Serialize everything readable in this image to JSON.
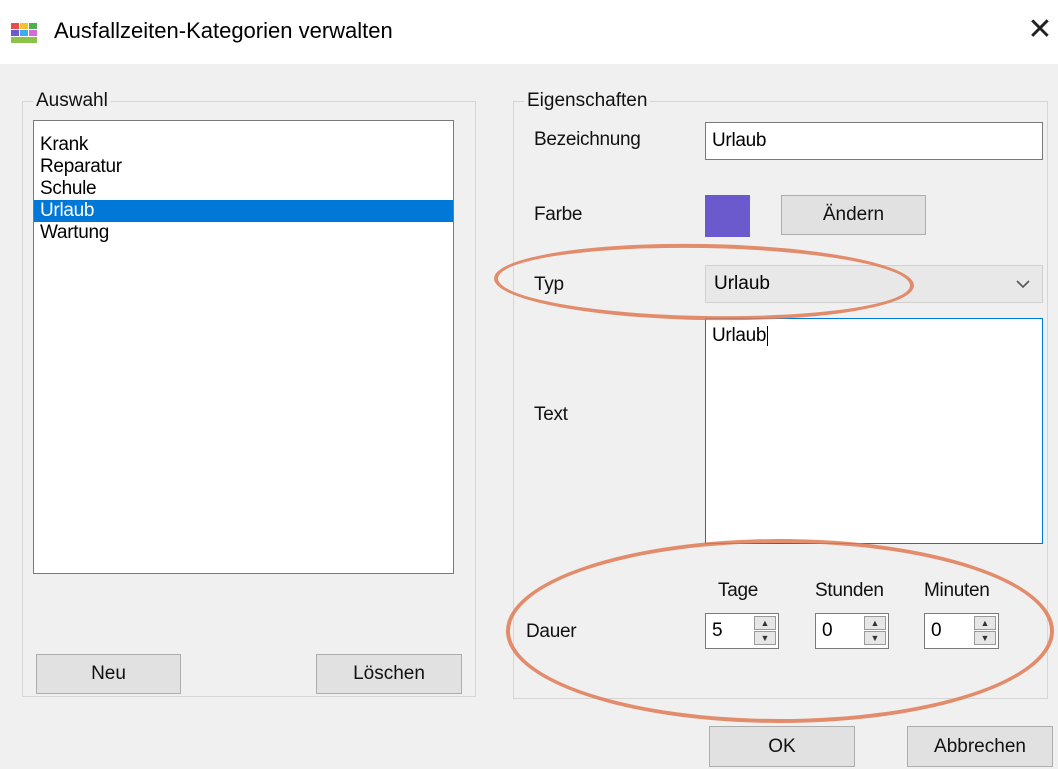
{
  "window": {
    "title": "Ausfallzeiten-Kategorien verwalten",
    "close_glyph": "✕"
  },
  "auswahl": {
    "label": "Auswahl",
    "items": [
      {
        "label": "Krank",
        "selected": false
      },
      {
        "label": "Reparatur",
        "selected": false
      },
      {
        "label": "Schule",
        "selected": false
      },
      {
        "label": "Urlaub",
        "selected": true
      },
      {
        "label": "Wartung",
        "selected": false
      }
    ],
    "new_button": "Neu",
    "delete_button": "Löschen"
  },
  "eigenschaften": {
    "label": "Eigenschaften",
    "bezeichnung_label": "Bezeichnung",
    "bezeichnung_value": "Urlaub",
    "farbe_label": "Farbe",
    "farbe_color": "#6a5acd",
    "aendern_button": "Ändern",
    "typ_label": "Typ",
    "typ_value": "Urlaub",
    "text_label": "Text",
    "text_value": "Urlaub",
    "dauer_label": "Dauer",
    "tage_label": "Tage",
    "tage_value": "5",
    "stunden_label": "Stunden",
    "stunden_value": "0",
    "minuten_label": "Minuten",
    "minuten_value": "0"
  },
  "footer": {
    "ok_button": "OK",
    "cancel_button": "Abbrechen"
  },
  "colors": {
    "accent": "#0078d7",
    "highlight_ellipse": "#e07a55"
  },
  "icons": {
    "app": "category-colors-icon",
    "dropdown": "chevron-down-icon",
    "spin_up": "spin-up-icon",
    "spin_down": "spin-down-icon"
  }
}
